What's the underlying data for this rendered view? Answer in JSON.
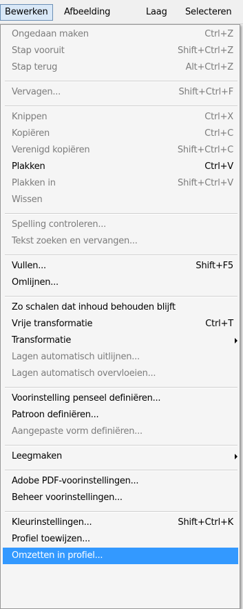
{
  "menubar": {
    "items": [
      {
        "label": "Bewerken"
      },
      {
        "label": "Afbeelding"
      },
      {
        "label": "Laag"
      },
      {
        "label": "Selecteren"
      }
    ]
  },
  "menu": {
    "items": [
      {
        "label": "Ongedaan maken",
        "shortcut": "Ctrl+Z",
        "enabled": false
      },
      {
        "label": "Stap vooruit",
        "shortcut": "Shift+Ctrl+Z",
        "enabled": false
      },
      {
        "label": "Stap terug",
        "shortcut": "Alt+Ctrl+Z",
        "enabled": false
      },
      {
        "label": "Vervagen...",
        "shortcut": "Shift+Ctrl+F",
        "enabled": false
      },
      {
        "label": "Knippen",
        "shortcut": "Ctrl+X",
        "enabled": false
      },
      {
        "label": "Kopiëren",
        "shortcut": "Ctrl+C",
        "enabled": false
      },
      {
        "label": "Verenigd kopiëren",
        "shortcut": "Shift+Ctrl+C",
        "enabled": false
      },
      {
        "label": "Plakken",
        "shortcut": "Ctrl+V",
        "enabled": true
      },
      {
        "label": "Plakken in",
        "shortcut": "Shift+Ctrl+V",
        "enabled": false
      },
      {
        "label": "Wissen",
        "shortcut": "",
        "enabled": false
      },
      {
        "label": "Spelling controleren...",
        "shortcut": "",
        "enabled": false
      },
      {
        "label": "Tekst zoeken en vervangen...",
        "shortcut": "",
        "enabled": false
      },
      {
        "label": "Vullen...",
        "shortcut": "Shift+F5",
        "enabled": true
      },
      {
        "label": "Omlijnen...",
        "shortcut": "",
        "enabled": true
      },
      {
        "label": "Zo schalen dat inhoud behouden blijft",
        "shortcut": "",
        "enabled": true
      },
      {
        "label": "Vrije transformatie",
        "shortcut": "Ctrl+T",
        "enabled": true
      },
      {
        "label": "Transformatie",
        "shortcut": "",
        "enabled": true,
        "submenu": true
      },
      {
        "label": "Lagen automatisch uitlijnen...",
        "shortcut": "",
        "enabled": false
      },
      {
        "label": "Lagen automatisch overvloeien...",
        "shortcut": "",
        "enabled": false
      },
      {
        "label": "Voorinstelling penseel definiëren...",
        "shortcut": "",
        "enabled": true
      },
      {
        "label": "Patroon definiëren...",
        "shortcut": "",
        "enabled": true
      },
      {
        "label": "Aangepaste vorm definiëren...",
        "shortcut": "",
        "enabled": false
      },
      {
        "label": "Leegmaken",
        "shortcut": "",
        "enabled": true,
        "submenu": true
      },
      {
        "label": "Adobe PDF-voorinstellingen...",
        "shortcut": "",
        "enabled": true
      },
      {
        "label": "Beheer voorinstellingen...",
        "shortcut": "",
        "enabled": true
      },
      {
        "label": "Kleurinstellingen...",
        "shortcut": "Shift+Ctrl+K",
        "enabled": true
      },
      {
        "label": "Profiel toewijzen...",
        "shortcut": "",
        "enabled": true
      },
      {
        "label": "Omzetten in profiel...",
        "shortcut": "",
        "enabled": true,
        "highlighted": true
      }
    ]
  },
  "colors": {
    "highlight": "#3399ff",
    "disabled_text": "#7c7c7c",
    "menubar_active": "#d9e8f7"
  }
}
